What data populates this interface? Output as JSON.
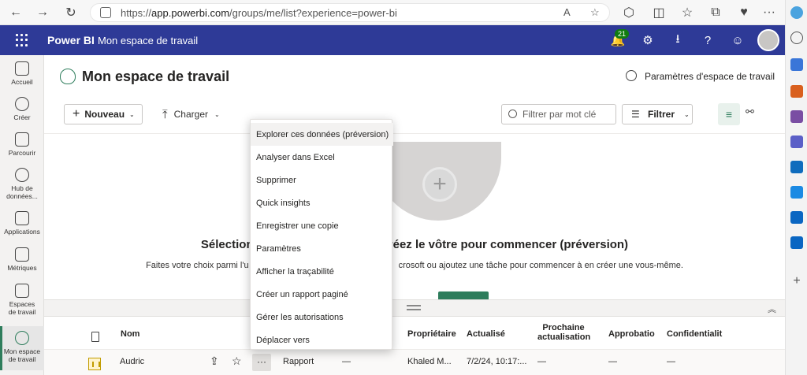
{
  "browser": {
    "url_prefix": "https://",
    "url_host": "app.powerbi.com",
    "url_path": "/groups/me/list?experience=power-bi"
  },
  "header": {
    "brand": "Power BI",
    "workspace": "Mon espace de travail",
    "notifications_count": "21"
  },
  "left_nav": [
    {
      "label": "Accueil",
      "icon": "home-icon"
    },
    {
      "label": "Créer",
      "icon": "plus-circle-icon"
    },
    {
      "label": "Parcourir",
      "icon": "folder-icon"
    },
    {
      "label": "Hub de données...",
      "icon": "data-hub-icon"
    },
    {
      "label": "Applications",
      "icon": "apps-icon"
    },
    {
      "label": "Métriques",
      "icon": "trophy-icon"
    },
    {
      "label": "Espaces de travail",
      "icon": "workspaces-icon"
    },
    {
      "label": "Mon espace de travail",
      "icon": "person-icon"
    }
  ],
  "page": {
    "title": "Mon espace de travail",
    "settings_label": "Paramètres d'espace de travail"
  },
  "toolbar": {
    "new_label": "Nouveau",
    "upload_label": "Charger",
    "search_placeholder": "Filtrer par mot clé",
    "filter_label": "Filtrer"
  },
  "empty_state": {
    "title_left": "Sélectionn",
    "title_right": "réez le vôtre pour commencer (préversion)",
    "subtitle_left": "Faites votre choix parmi l'u",
    "subtitle_right": "crosoft ou ajoutez une tâche pour commencer à en créer une vous-même."
  },
  "table": {
    "headers": {
      "name": "Nom",
      "owner": "Propriétaire",
      "refreshed": "Actualisé",
      "next_refresh_1": "Prochaine",
      "next_refresh_2": "actualisation",
      "approval": "Approbatio",
      "sensitivity": "Confidentialit"
    },
    "rows": [
      {
        "name": "Audric",
        "more": "···",
        "type": "Rapport",
        "task": "—",
        "owner": "Khaled M...",
        "refreshed": "7/2/24, 10:17:...",
        "next_refresh": "—",
        "approval": "—",
        "sensitivity": "—"
      }
    ]
  },
  "context_menu": {
    "items": [
      "Explorer ces données (préversion)",
      "Analyser dans Excel",
      "Supprimer",
      "Quick insights",
      "Enregistrer une copie",
      "Paramètres",
      "Afficher la traçabilité",
      "Créer un rapport paginé",
      "Gérer les autorisations",
      "Déplacer vers"
    ]
  },
  "colors": {
    "header_bg": "#2e3a97",
    "accent_green": "#2e7d5c"
  }
}
